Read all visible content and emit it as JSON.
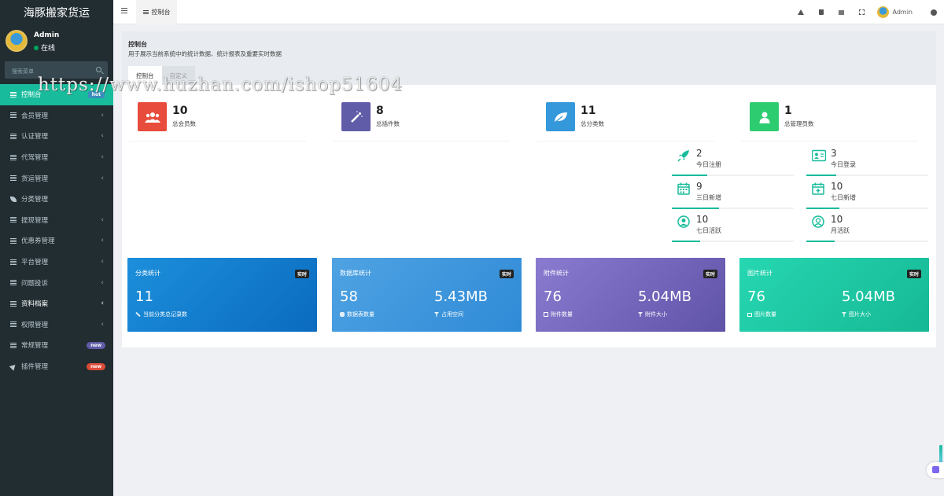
{
  "app": {
    "title": "海豚搬家货运"
  },
  "user": {
    "name": "Admin",
    "status": "在线"
  },
  "sidebar": {
    "search_placeholder": "搜索菜单",
    "items": [
      {
        "label": "控制台",
        "badge": "hot"
      },
      {
        "label": "会员管理",
        "chevron": "‹"
      },
      {
        "label": "认证管理",
        "chevron": "‹"
      },
      {
        "label": "代驾管理",
        "chevron": "‹"
      },
      {
        "label": "货运管理",
        "chevron": "‹"
      },
      {
        "label": "分类管理"
      },
      {
        "label": "提现管理",
        "chevron": "‹"
      },
      {
        "label": "优惠券管理",
        "chevron": "‹"
      },
      {
        "label": "平台管理",
        "chevron": "‹"
      },
      {
        "label": "问题投诉",
        "chevron": "‹"
      },
      {
        "label": "资料档案",
        "chevron": "‹"
      },
      {
        "label": "权限管理",
        "chevron": "‹"
      },
      {
        "label": "常规管理",
        "badge": "new"
      },
      {
        "label": "插件管理",
        "badge": "new"
      }
    ]
  },
  "topnav": {
    "tab_label": "控制台",
    "admin_label": "Admin"
  },
  "content_header": {
    "title": "控制台",
    "description": "用于展示当前系统中的统计数据、统计报表及重要实时数据",
    "tabs": [
      "控制台",
      "自定义"
    ]
  },
  "stats": [
    {
      "value": "10",
      "label": "总会员数",
      "color": "#e74c3c",
      "icon": "users-icon"
    },
    {
      "value": "8",
      "label": "总插件数",
      "color": "#605ca8",
      "icon": "magic-wand-icon"
    },
    {
      "value": "11",
      "label": "总分类数",
      "color": "#3498db",
      "icon": "leaf-icon"
    },
    {
      "value": "1",
      "label": "总管理员数",
      "color": "#2ecc71",
      "icon": "user-icon"
    }
  ],
  "mini_stats": [
    {
      "value": "2",
      "label": "今日注册",
      "icon": "rocket-icon"
    },
    {
      "value": "3",
      "label": "今日登录",
      "icon": "id-card-icon"
    },
    {
      "value": "9",
      "label": "三日新增",
      "icon": "calendar-icon"
    },
    {
      "value": "10",
      "label": "七日新增",
      "icon": "calendar-plus-icon"
    },
    {
      "value": "10",
      "label": "七日活跃",
      "icon": "user-circle-icon"
    },
    {
      "value": "10",
      "label": "月活跃",
      "icon": "user-circle-outline-icon"
    }
  ],
  "cards": [
    {
      "title": "分类统计",
      "badge": "实时",
      "v1": "11",
      "l1": "当前分类总记录数",
      "v2": "",
      "l2": "",
      "gradient": [
        "#1c8fdb",
        "#0b6bbf"
      ]
    },
    {
      "title": "数据库统计",
      "badge": "实时",
      "v1": "58",
      "l1": "数据表数量",
      "v2": "5.43MB",
      "l2": "占用空间",
      "gradient": [
        "#4fa3e3",
        "#2f8ad6"
      ]
    },
    {
      "title": "附件统计",
      "badge": "实时",
      "v1": "76",
      "l1": "附件数量",
      "v2": "5.04MB",
      "l2": "附件大小",
      "gradient": [
        "#8a7bd0",
        "#5f53a8"
      ]
    },
    {
      "title": "图片统计",
      "badge": "实时",
      "v1": "76",
      "l1": "图片数量",
      "v2": "5.04MB",
      "l2": "图片大小",
      "gradient": [
        "#26d7b2",
        "#16b894"
      ]
    }
  ],
  "watermark": "https://www.huzhan.com/ishop51604"
}
